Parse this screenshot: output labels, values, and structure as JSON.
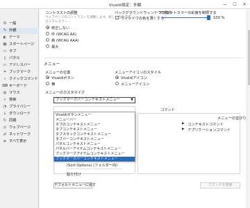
{
  "window": {
    "title": "Vivaldi設定：外観",
    "minimize": "—",
    "maximize": "☐",
    "close": "✕"
  },
  "sidebar": {
    "items": [
      {
        "label": "一般",
        "icon": "⚙"
      },
      {
        "label": "外観",
        "icon": "✎"
      },
      {
        "label": "テーマ",
        "icon": "◐"
      },
      {
        "label": "スタートページ",
        "icon": "▦"
      },
      {
        "label": "タブ",
        "icon": "▭"
      },
      {
        "label": "パネル",
        "icon": "▯"
      },
      {
        "label": "アドレスバー",
        "icon": "▭"
      },
      {
        "label": "ブックマーク",
        "icon": "✦"
      },
      {
        "label": "クイックコマンド",
        "icon": "»"
      },
      {
        "label": "キーボード",
        "icon": "⌨"
      },
      {
        "label": "マウス",
        "icon": "◍"
      },
      {
        "label": "検索",
        "icon": "⌕"
      },
      {
        "label": "プライバシー",
        "icon": "◔"
      },
      {
        "label": "ダウンロード",
        "icon": "↓"
      },
      {
        "label": "同期",
        "icon": "↻"
      },
      {
        "label": "ウェブページ",
        "icon": "◎"
      },
      {
        "label": "ネットワーク",
        "icon": "⇄"
      },
      {
        "label": "すべて表示",
        "icon": "≡"
      }
    ]
  },
  "contrast": {
    "heading": "コントラストの調整",
    "desc1": "ウェブページのコントラストを調整します。新しい色を作成",
    "desc2": "カスタムカラー...",
    "options": [
      "修正しない",
      "中 (WCAG AA)",
      "高 (WCAG AAA)",
      "最大"
    ]
  },
  "background": {
    "heading": "バックグラウンドウィンドウの動作",
    "checkbox": "ウィンドウの色を薄くする"
  },
  "accent": {
    "heading": "アクセントカラーの彩度を制限する",
    "value": "100 %"
  },
  "menu": {
    "heading": "メニュー",
    "position_heading": "メニューの位置",
    "position_options": [
      "Vivaldiボタン",
      "横"
    ],
    "icon_heading": "メニューアイコンのスタイル",
    "icon_options": [
      "Vivaldiアイコン",
      "メニューアイコン"
    ],
    "customize_heading": "メニューのカスタマイズ",
    "selected": "ブックマークバーコンテキストメニュー",
    "command_heading": "コマンド",
    "menu_items_heading": "メニューの並びり",
    "dropdown_options": [
      "Vivaldiボタンメニュー",
      "メニューバー",
      "タブのコンテキストメニュー",
      "タブコンテキストメニュー",
      "タブスタックコンテキストメニュー",
      "タブバーコンテキストメニュー",
      "パネルコンテキストメニュー",
      "パネルバーアイテムコンテキストメニュー",
      "ブックマークアイテムコンテキストメニュー",
      "ブックマークバーコンテキストメニュー"
    ],
    "tree_items": [
      "コンテキストコマンド",
      "アプリケーションコマンド"
    ],
    "left_panel_row": "(Sort Options) (フォルダー内)",
    "left_panel_row2": "貼り付け",
    "reset_button": "デフォルトメニューに戻す",
    "add_command_placeholder": "コマンドを検索"
  }
}
